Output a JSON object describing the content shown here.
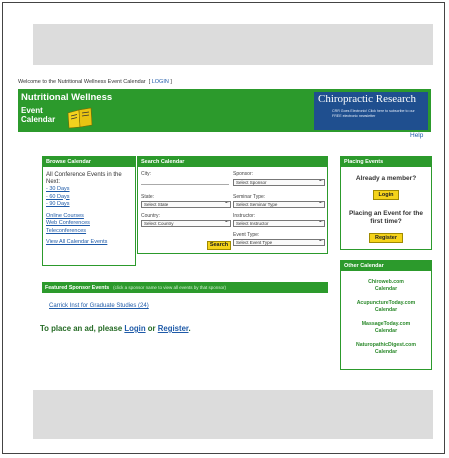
{
  "welcome": {
    "text": "Welcome to the Nutritional Wellness Event Calendar",
    "login_link": "LOGIN"
  },
  "header": {
    "logo_title": "Nutritional Wellness",
    "logo_sub": "Event Calendar",
    "banner_title": "Chiropractic Research",
    "banner_text": "CRR Goes Electronic! Click here to subscribe to our FREE electronic newsletter"
  },
  "help_link": "Help",
  "browse": {
    "heading": "Browse Calendar",
    "intro": "All Conference Events in the Next:",
    "ranges": [
      "- 30 Days",
      "- 60 Days",
      "- 90 Days"
    ],
    "links": [
      "Online Courses",
      "Web Conferences",
      "Teleconferences"
    ],
    "view_all": "View All Calendar Events"
  },
  "search": {
    "heading": "Search Calendar",
    "city_label": "City:",
    "sponsor_label": "Sponsor:",
    "sponsor_value": "Select Sponsor",
    "state_label": "State:",
    "state_value": "Select State",
    "seminar_type_label": "Seminar Type:",
    "seminar_type_value": "Select Seminar Type",
    "country_label": "Country:",
    "country_value": "Select Country",
    "instructor_label": "Instructor:",
    "instructor_value": "Select Instructor",
    "event_type_label": "Event Type:",
    "event_type_value": "Select Event Type",
    "button": "Search"
  },
  "featured": {
    "heading": "Featured Sponsor Events",
    "note": "(click a sponsor name to view all events by that sponsor)",
    "sponsor": "Carrick Inst for Graduate Studies (24)"
  },
  "place_ad": {
    "prefix": "To place an ad, please",
    "login": "Login",
    "or": "or",
    "register": "Register",
    "suffix": "."
  },
  "placing": {
    "heading": "Placing Events",
    "member_q": "Already a member?",
    "login_btn": "Login",
    "first_q": "Placing an Event for the first time?",
    "register_btn": "Register"
  },
  "other": {
    "heading": "Other Calendar",
    "sites": [
      {
        "name": "Chiroweb.com",
        "sub": "Calendar"
      },
      {
        "name": "AcupunctureToday.com",
        "sub": "Calendar"
      },
      {
        "name": "MassageToday.com",
        "sub": "Calendar"
      },
      {
        "name": "NaturopathicDigest.com",
        "sub": "Calendar"
      }
    ]
  },
  "colors": {
    "brand_green": "#2c9a2c",
    "button_yellow": "#f5d31a",
    "link_blue": "#1e5aa8",
    "banner_blue": "#1f4f8f"
  }
}
